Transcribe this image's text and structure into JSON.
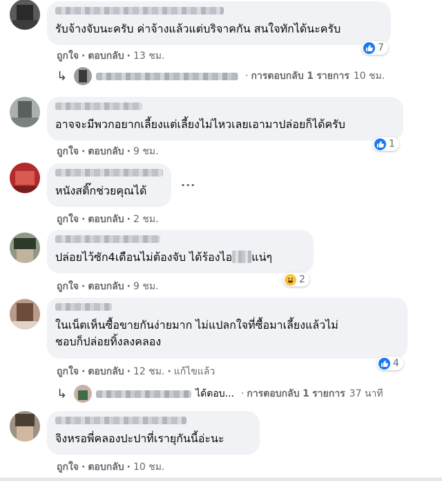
{
  "actions": {
    "like": "ถูกใจ",
    "reply": "ตอบกลับ",
    "separator": "·",
    "edited": "แก้ไขแล้ว"
  },
  "colors": {
    "bubble": "#f0f2f5",
    "like_blue": "#1877f2",
    "meta_gray": "#65676b",
    "haha_yellow": "#f7c640"
  },
  "comments": [
    {
      "text": "รับจ้างจับนะครับ ค่าจ้างแล้วแต่บริจาคกัน สนใจทักได้นะครับ",
      "reaction_icon": "like-icon",
      "reaction_count": "7",
      "time": "13 ชม."
    },
    {
      "text": "อาจจะมีพวกอยากเลี้ยงแต่เลี้ยงไม่ไหวเลยเอามาปล่อยก็ได้ครับ",
      "reaction_icon": "like-icon",
      "reaction_count": "1",
      "time": "9 ชม."
    },
    {
      "text": "หนังสติ๊กช่วยคุณได้",
      "time": "2 ชม.",
      "menu": "···"
    },
    {
      "text_before": "ปล่อยไว้ซัก4เดือนไม่ต้องจับ ได้ร้องไอ",
      "text_after": "แน่ๆ",
      "reaction_icon": "haha-icon",
      "reaction_count": "2",
      "time": "9 ชม."
    },
    {
      "text": "ในเน็ตเห็นซื้อขายกันง่ายมาก ไม่แปลกใจที่ซื้อมาเลี้ยงแล้วไม่\nชอบก็ปล่อยทิ้งลงคลอง",
      "reaction_icon": "like-icon",
      "reaction_count": "4",
      "time": "12 ชม."
    },
    {
      "text": "จิงหรอพี่คลองปะปาที่เรายุกันนี้อ่ะนะ",
      "time": "10 ชม."
    }
  ],
  "replies": [
    {
      "summary_prefix": "การตอบกลับ",
      "count": "1",
      "unit": "รายการ",
      "time": "10 ชม."
    },
    {
      "snippet": "ได้ตอบ...",
      "summary_prefix": "การตอบกลับ",
      "count": "1",
      "unit": "รายการ",
      "time": "37 นาที"
    }
  ]
}
